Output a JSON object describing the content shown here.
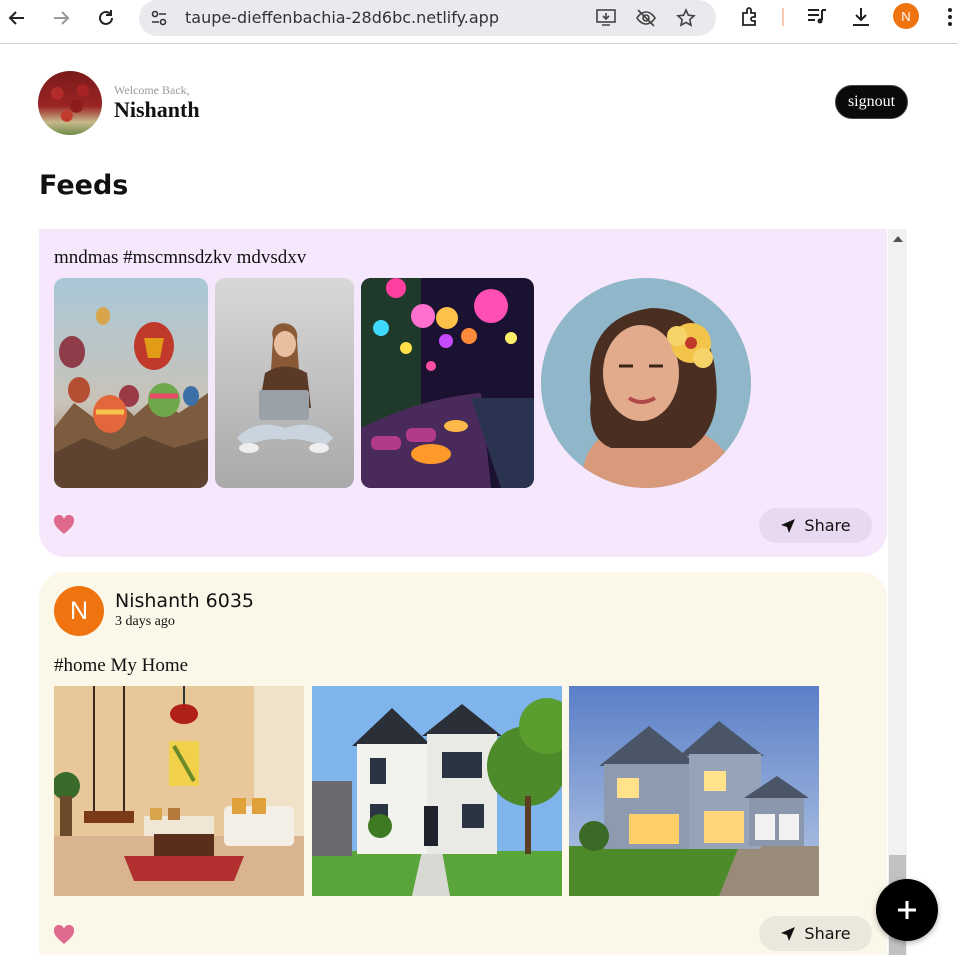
{
  "browser": {
    "url": "taupe-dieffenbachia-28d6bc.netlify.app",
    "profile_initial": "N"
  },
  "header": {
    "welcome": "Welcome Back,",
    "username": "Nishanth",
    "signout_label": "signout"
  },
  "page": {
    "title": "Feeds"
  },
  "posts": [
    {
      "caption": "mndmas #mscmnsdzkv mdvsdxv",
      "share_label": "Share"
    },
    {
      "author_initial": "N",
      "author_name": "Nishanth 6035",
      "time": "3 days ago",
      "caption": "#home My Home",
      "share_label": "Share"
    }
  ],
  "colors": {
    "accent": "#ef7410",
    "post1_bg": "#f6e7fc",
    "post2_bg": "#fcf8e9",
    "heart": "#e06a8e"
  },
  "icons": [
    "back-arrow-icon",
    "forward-arrow-icon",
    "reload-icon",
    "site-settings-icon",
    "install-icon",
    "eye-off-icon",
    "star-icon",
    "extensions-icon",
    "media-icon",
    "download-icon",
    "more-vert-icon",
    "heart-icon",
    "share-arrow-icon",
    "plus-icon"
  ]
}
